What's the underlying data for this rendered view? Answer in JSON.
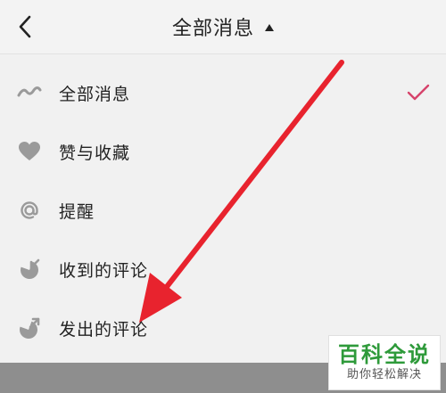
{
  "header": {
    "title": "全部消息",
    "back_icon": "chevron-left-icon",
    "dropdown_icon": "caret-up-icon"
  },
  "menu": {
    "items": [
      {
        "label": "全部消息",
        "icon": "wave-icon",
        "selected": true
      },
      {
        "label": "赞与收藏",
        "icon": "heart-icon",
        "selected": false
      },
      {
        "label": "提醒",
        "icon": "at-icon",
        "selected": false
      },
      {
        "label": "收到的评论",
        "icon": "comment-received-icon",
        "selected": false
      },
      {
        "label": "发出的评论",
        "icon": "comment-sent-icon",
        "selected": false
      }
    ],
    "check_color": "#d6436b"
  },
  "annotation": {
    "arrow_color": "#e8232e"
  },
  "watermark": {
    "title": "百科全说",
    "subtitle": "助你轻松解决",
    "color": "#2e9a3a"
  }
}
